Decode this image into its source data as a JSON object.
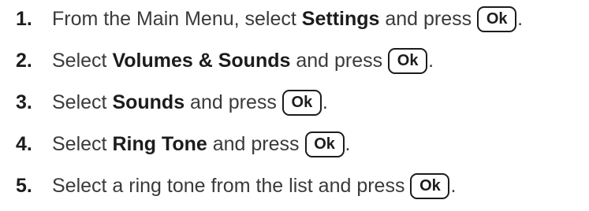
{
  "steps": [
    {
      "number": "1.",
      "text_before": "From the Main Menu, select ",
      "bold": "Settings",
      "text_after": " and press",
      "key": "Ok",
      "end": "."
    },
    {
      "number": "2.",
      "text_before": "Select ",
      "bold": "Volumes & Sounds",
      "text_after": " and press",
      "key": "Ok",
      "end": "."
    },
    {
      "number": "3.",
      "text_before": "Select ",
      "bold": "Sounds",
      "text_after": " and press",
      "key": "Ok",
      "end": "."
    },
    {
      "number": "4.",
      "text_before": "Select ",
      "bold": "Ring Tone",
      "text_after": " and press",
      "key": "Ok",
      "end": "."
    },
    {
      "number": "5.",
      "text_before": "Select a ring tone from the list and press",
      "bold": "",
      "text_after": "",
      "key": "Ok",
      "end": "."
    }
  ]
}
